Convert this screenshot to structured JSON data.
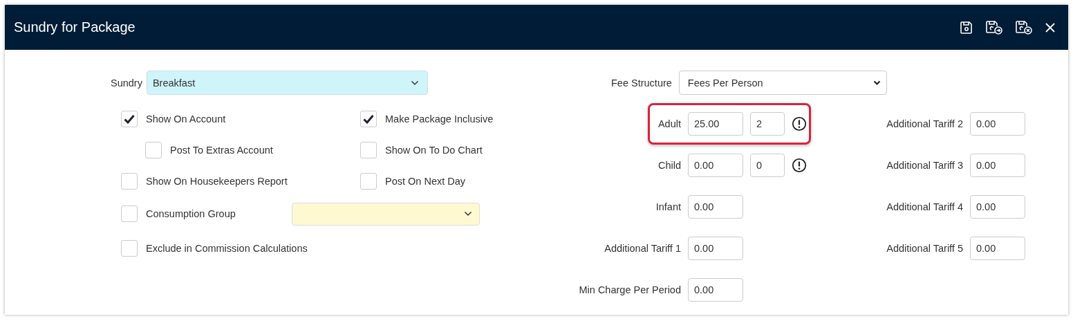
{
  "window": {
    "title": "Sundry for Package"
  },
  "sundry": {
    "label": "Sundry",
    "value": "Breakfast"
  },
  "options_left": [
    {
      "kind": "checkbox",
      "label": "Show On Account",
      "checked": true,
      "indented": false
    },
    {
      "kind": "checkbox",
      "label": "Post To Extras Account",
      "checked": false,
      "indented": true
    },
    {
      "kind": "checkbox",
      "label": "Show On Housekeepers Report",
      "checked": false,
      "indented": false
    },
    {
      "kind": "checkbox_select",
      "label": "Consumption Group",
      "checked": false,
      "indented": false
    },
    {
      "kind": "checkbox",
      "label": "Exclude in Commission Calculations",
      "checked": false,
      "indented": false
    }
  ],
  "options_right": [
    {
      "kind": "checkbox",
      "label": "Make Package Inclusive",
      "checked": true,
      "indented": false
    },
    {
      "kind": "checkbox",
      "label": "Show On To Do Chart",
      "checked": false,
      "indented": false
    },
    {
      "kind": "checkbox",
      "label": "Post On Next Day",
      "checked": false,
      "indented": false
    }
  ],
  "fee_structure": {
    "label": "Fee Structure",
    "value": "Fees Per Person"
  },
  "fees": [
    {
      "label": "Adult",
      "value": "25.00",
      "count": "2",
      "warning": true,
      "highlighted": true
    },
    {
      "label": "Child",
      "value": "0.00",
      "count": "0",
      "warning": true,
      "highlighted": false
    },
    {
      "label": "Infant",
      "value": "0.00",
      "highlighted": false
    },
    {
      "label": "Additional Tariff 1",
      "value": "0.00",
      "highlighted": false
    },
    {
      "label": "Min Charge Per Period",
      "value": "0.00",
      "highlighted": false
    }
  ],
  "additional_tariffs": [
    {
      "label": "Additional Tariff 2",
      "value": "0.00"
    },
    {
      "label": "Additional Tariff 3",
      "value": "0.00"
    },
    {
      "label": "Additional Tariff 4",
      "value": "0.00"
    },
    {
      "label": "Additional Tariff 5",
      "value": "0.00"
    }
  ]
}
